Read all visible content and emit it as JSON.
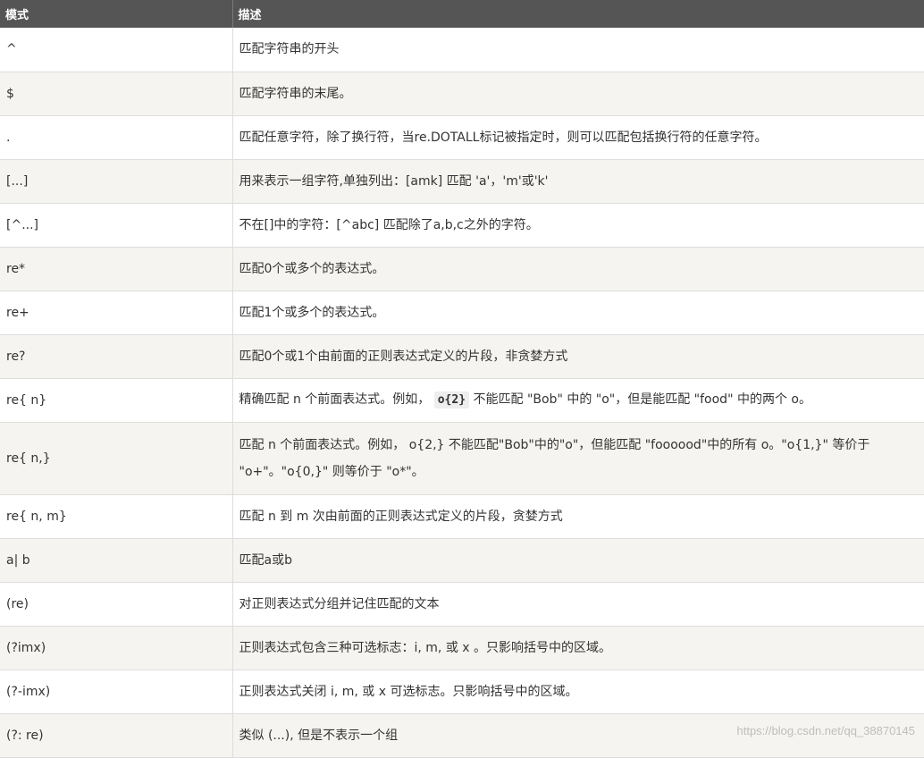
{
  "header": {
    "col1": "模式",
    "col2": "描述"
  },
  "rows": [
    {
      "pattern": "^",
      "desc": "匹配字符串的开头"
    },
    {
      "pattern": "$",
      "desc": "匹配字符串的末尾。"
    },
    {
      "pattern": ".",
      "desc": "匹配任意字符，除了换行符，当re.DOTALL标记被指定时，则可以匹配包括换行符的任意字符。"
    },
    {
      "pattern": "[...]",
      "desc": "用来表示一组字符,单独列出：[amk] 匹配 'a'，'m'或'k'"
    },
    {
      "pattern": "[^...]",
      "desc": "不在[]中的字符：[^abc] 匹配除了a,b,c之外的字符。"
    },
    {
      "pattern": "re*",
      "desc": "匹配0个或多个的表达式。"
    },
    {
      "pattern": "re+",
      "desc": "匹配1个或多个的表达式。"
    },
    {
      "pattern": "re?",
      "desc": "匹配0个或1个由前面的正则表达式定义的片段，非贪婪方式"
    },
    {
      "pattern": "re{ n}",
      "desc_pre": "精确匹配 n 个前面表达式。例如，",
      "desc_code": "o{2}",
      "desc_post": "不能匹配 \"Bob\" 中的 \"o\"，但是能匹配 \"food\" 中的两个 o。"
    },
    {
      "pattern": "re{ n,}",
      "desc": "匹配 n 个前面表达式。例如， o{2,} 不能匹配\"Bob\"中的\"o\"，但能匹配 \"foooood\"中的所有 o。\"o{1,}\" 等价于 \"o+\"。\"o{0,}\" 则等价于 \"o*\"。"
    },
    {
      "pattern": "re{ n, m}",
      "desc": "匹配 n 到 m 次由前面的正则表达式定义的片段，贪婪方式"
    },
    {
      "pattern": "a| b",
      "desc": "匹配a或b"
    },
    {
      "pattern": "(re)",
      "desc": "对正则表达式分组并记住匹配的文本"
    },
    {
      "pattern": "(?imx)",
      "desc": "正则表达式包含三种可选标志：i, m, 或 x 。只影响括号中的区域。"
    },
    {
      "pattern": "(?-imx)",
      "desc": "正则表达式关闭 i, m, 或 x 可选标志。只影响括号中的区域。"
    },
    {
      "pattern": "(?: re)",
      "desc": "类似 (...), 但是不表示一个组"
    }
  ],
  "watermark": "https://blog.csdn.net/qq_38870145"
}
